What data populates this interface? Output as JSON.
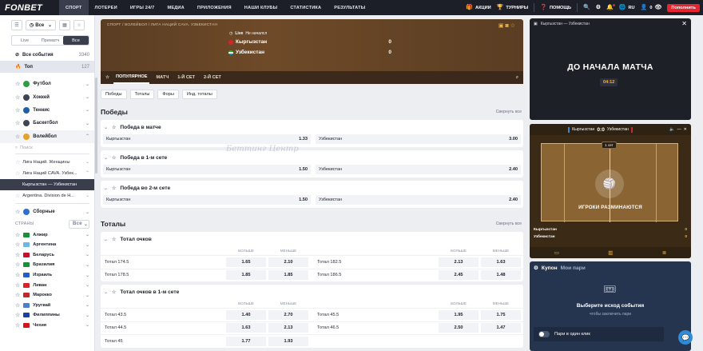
{
  "brand": "FONBET",
  "nav": [
    "СПОРТ",
    "ЛОТЕРЕИ",
    "ИГРЫ 24/7",
    "МЕДИА",
    "ПРИЛОЖЕНИЯ",
    "НАШИ КЛУБЫ",
    "СТАТИСТИКА",
    "РЕЗУЛЬТАТЫ"
  ],
  "top_right": {
    "promo": "АКЦИИ",
    "tournaments": "ТУРНИРЫ",
    "help": "ПОМОЩЬ",
    "lang": "RU",
    "balance": "0",
    "replenish": "Пополнить"
  },
  "sidebar": {
    "select_label": "Все",
    "tabs": [
      "Live",
      "Прематч",
      "Все"
    ],
    "all_events": {
      "label": "Все события",
      "count": "3340"
    },
    "top": {
      "label": "Топ",
      "count": "127"
    },
    "sports": [
      {
        "label": "Футбол",
        "color": "#2e9e44"
      },
      {
        "label": "Хоккей",
        "color": "#3b4556"
      },
      {
        "label": "Теннис",
        "color": "#1f5fa8"
      },
      {
        "label": "Баскетбол",
        "color": "#3b4556"
      }
    ],
    "volleyball": "Волейбол",
    "search_placeholder": "Поиск",
    "leagues": [
      "Лига Наций. Женщины",
      "Лига Наций CAVA. Узбек...",
      "Кыргызстан — Узбекистан",
      "Argentina. Division de H..."
    ],
    "national": "Сборные",
    "countries_label": "СТРАНЫ",
    "countries_select": "Все",
    "countries": [
      {
        "label": "Алжир",
        "color": "#1a8f3a"
      },
      {
        "label": "Аргентина",
        "color": "#6fb6e8"
      },
      {
        "label": "Беларусь",
        "color": "#c8102e"
      },
      {
        "label": "Бразилия",
        "color": "#1a8f3a"
      },
      {
        "label": "Израиль",
        "color": "#1f5fc8"
      },
      {
        "label": "Ливан",
        "color": "#d8232a"
      },
      {
        "label": "Марокко",
        "color": "#c1272d"
      },
      {
        "label": "Уругвай",
        "color": "#4a7fd0"
      },
      {
        "label": "Филиппины",
        "color": "#1a3fa0"
      },
      {
        "label": "Чехия",
        "color": "#d7141a"
      }
    ]
  },
  "event": {
    "breadcrumb": "СПОРТ / ВОЛЕЙБОЛ / ЛИГА НАЦИЙ CAVA. УЗБЕКИСТАН",
    "live": "Live",
    "status": "Не началсл",
    "teams": [
      {
        "name": "Кыргызстан",
        "score": "0",
        "color": "#d8232a"
      },
      {
        "name": "Узбекистан",
        "score": "0",
        "color": "#1eb53a"
      }
    ],
    "tabs": [
      "ПОПУЛЯРНОЕ",
      "МАТЧ",
      "1-Й СЕТ",
      "2-Й СЕТ"
    ]
  },
  "chips": [
    "Победы",
    "Тоталы",
    "Форы",
    "Инд. тоталы"
  ],
  "wins": {
    "title": "Победы",
    "collapse": "Свернуть все",
    "markets": [
      {
        "name": "Победа в матче",
        "home": "Кыргызстан",
        "home_odds": "1.33",
        "away": "Узбекистан",
        "away_odds": "3.00"
      },
      {
        "name": "Победа в 1-м сете",
        "home": "Кыргызстан",
        "home_odds": "1.50",
        "away": "Узбекистан",
        "away_odds": "2.40"
      },
      {
        "name": "Победа во 2-м сете",
        "home": "Кыргызстан",
        "home_odds": "1.50",
        "away": "Узбекистан",
        "away_odds": "2.40"
      }
    ]
  },
  "totals": {
    "title": "Тоталы",
    "collapse": "Свернуть все",
    "over": "БОЛЬШЕ",
    "under": "МЕНЬШЕ",
    "markets": [
      {
        "name": "Тотал очков",
        "rows": [
          {
            "l": "Тотал 174.5",
            "o": "1.65",
            "u": "2.10",
            "l2": "Тотал 182.5",
            "o2": "2.13",
            "u2": "1.63"
          },
          {
            "l": "Тотал 178.5",
            "o": "1.85",
            "u": "1.85",
            "l2": "Тотал 186.5",
            "o2": "2.45",
            "u2": "1.48"
          }
        ]
      },
      {
        "name": "Тотал очков в 1-м сете",
        "rows": [
          {
            "l": "Тотал 43.5",
            "o": "1.40",
            "u": "2.70",
            "l2": "Тотал 45.5",
            "o2": "1.95",
            "u2": "1.75"
          },
          {
            "l": "Тотал 44.5",
            "o": "1.63",
            "u": "2.13",
            "l2": "Тотал 46.5",
            "o2": "2.50",
            "u2": "1.47"
          },
          {
            "l": "Тотал 45",
            "o": "1.77",
            "u": "1.93",
            "l2": "",
            "o2": "",
            "u2": ""
          }
        ]
      }
    ]
  },
  "watermark": "Беттинг Центр",
  "stream": {
    "title": "Кыргызстан — Узбекистан",
    "headline": "ДО НАЧАЛА МАТЧА",
    "time": "04:12"
  },
  "scoreboard": {
    "home": "Кыргызстан",
    "score": "0:0",
    "away": "Узбекистан",
    "set": "1 сет",
    "message": "ИГРОКИ РАЗМИНАЮТСЯ",
    "rows": [
      {
        "team": "Кыргызстан",
        "pts": "0"
      },
      {
        "team": "Узбекистан",
        "pts": "0"
      }
    ]
  },
  "coupon": {
    "tab1": "Купон",
    "tab2": "Мои пари",
    "title": "Выберите исход события",
    "subtitle": "чтобы заключить пари",
    "parlay": "Пари в один клик"
  }
}
